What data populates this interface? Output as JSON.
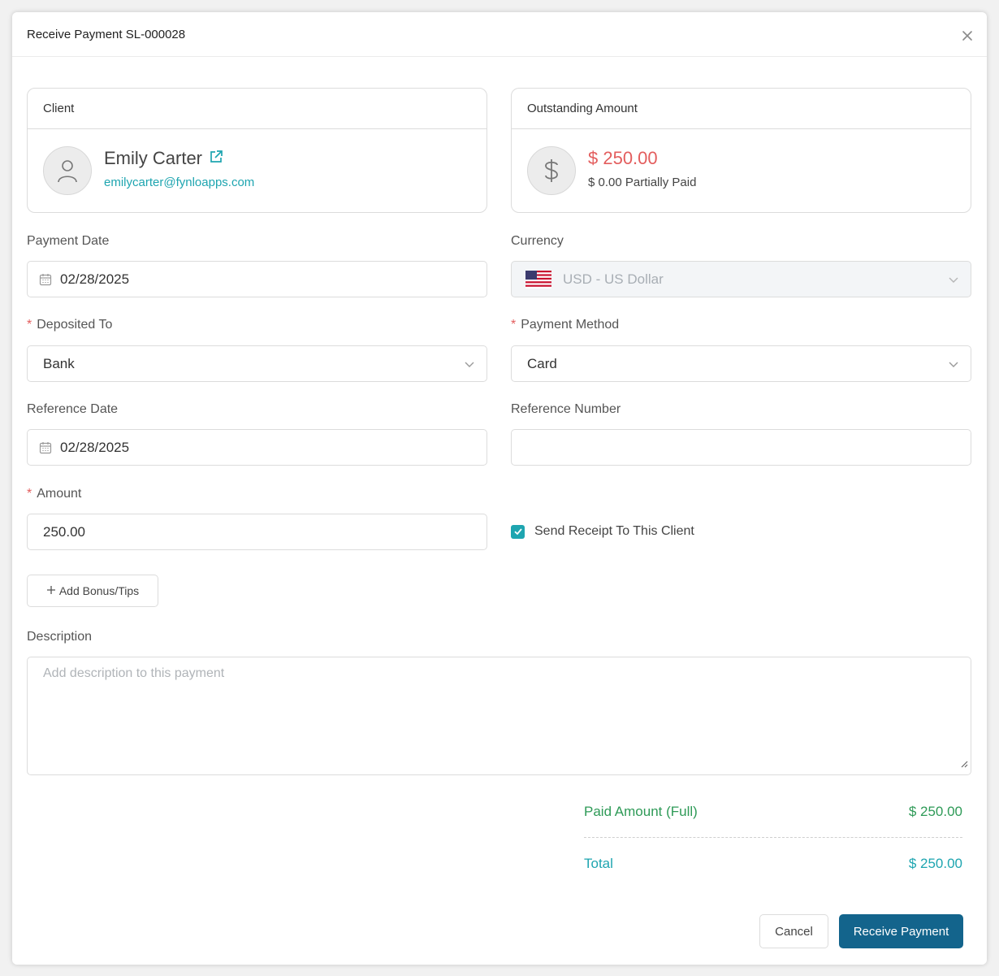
{
  "modal": {
    "title": "Receive Payment SL-000028",
    "close_icon": "close-icon"
  },
  "client_card": {
    "heading": "Client",
    "name": "Emily Carter",
    "email": "emilycarter@fynloapps.com",
    "avatar_icon": "user-icon",
    "link_icon": "external-link-icon"
  },
  "outstanding_card": {
    "heading": "Outstanding Amount",
    "amount": "$ 250.00",
    "status": "$ 0.00 Partially Paid",
    "icon": "dollar-icon"
  },
  "form": {
    "payment_date": {
      "label": "Payment Date",
      "value": "02/28/2025"
    },
    "currency": {
      "label": "Currency",
      "value": "USD - US Dollar",
      "flag_icon": "us-flag-icon"
    },
    "deposited_to": {
      "label": "Deposited To",
      "value": "Bank",
      "required_mark": "*"
    },
    "payment_method": {
      "label": "Payment Method",
      "value": "Card",
      "required_mark": "*"
    },
    "reference_date": {
      "label": "Reference Date",
      "value": "02/28/2025"
    },
    "reference_number": {
      "label": "Reference Number",
      "value": ""
    },
    "amount": {
      "label": "Amount",
      "value": "250.00",
      "required_mark": "*"
    },
    "send_receipt": {
      "label": "Send Receipt To This Client",
      "checked": true
    },
    "add_bonus_label": "Add Bonus/Tips",
    "description": {
      "label": "Description",
      "placeholder": "Add description to this payment"
    }
  },
  "summary": {
    "paid_label": "Paid Amount (Full)",
    "paid_value": "$ 250.00",
    "total_label": "Total",
    "total_value": "$ 250.00"
  },
  "footer": {
    "cancel_label": "Cancel",
    "submit_label": "Receive Payment"
  },
  "colors": {
    "accent": "#1ea5b0",
    "primary_button": "#13648c",
    "outstanding_red": "#e35d5d",
    "paid_green": "#2e9a57"
  }
}
